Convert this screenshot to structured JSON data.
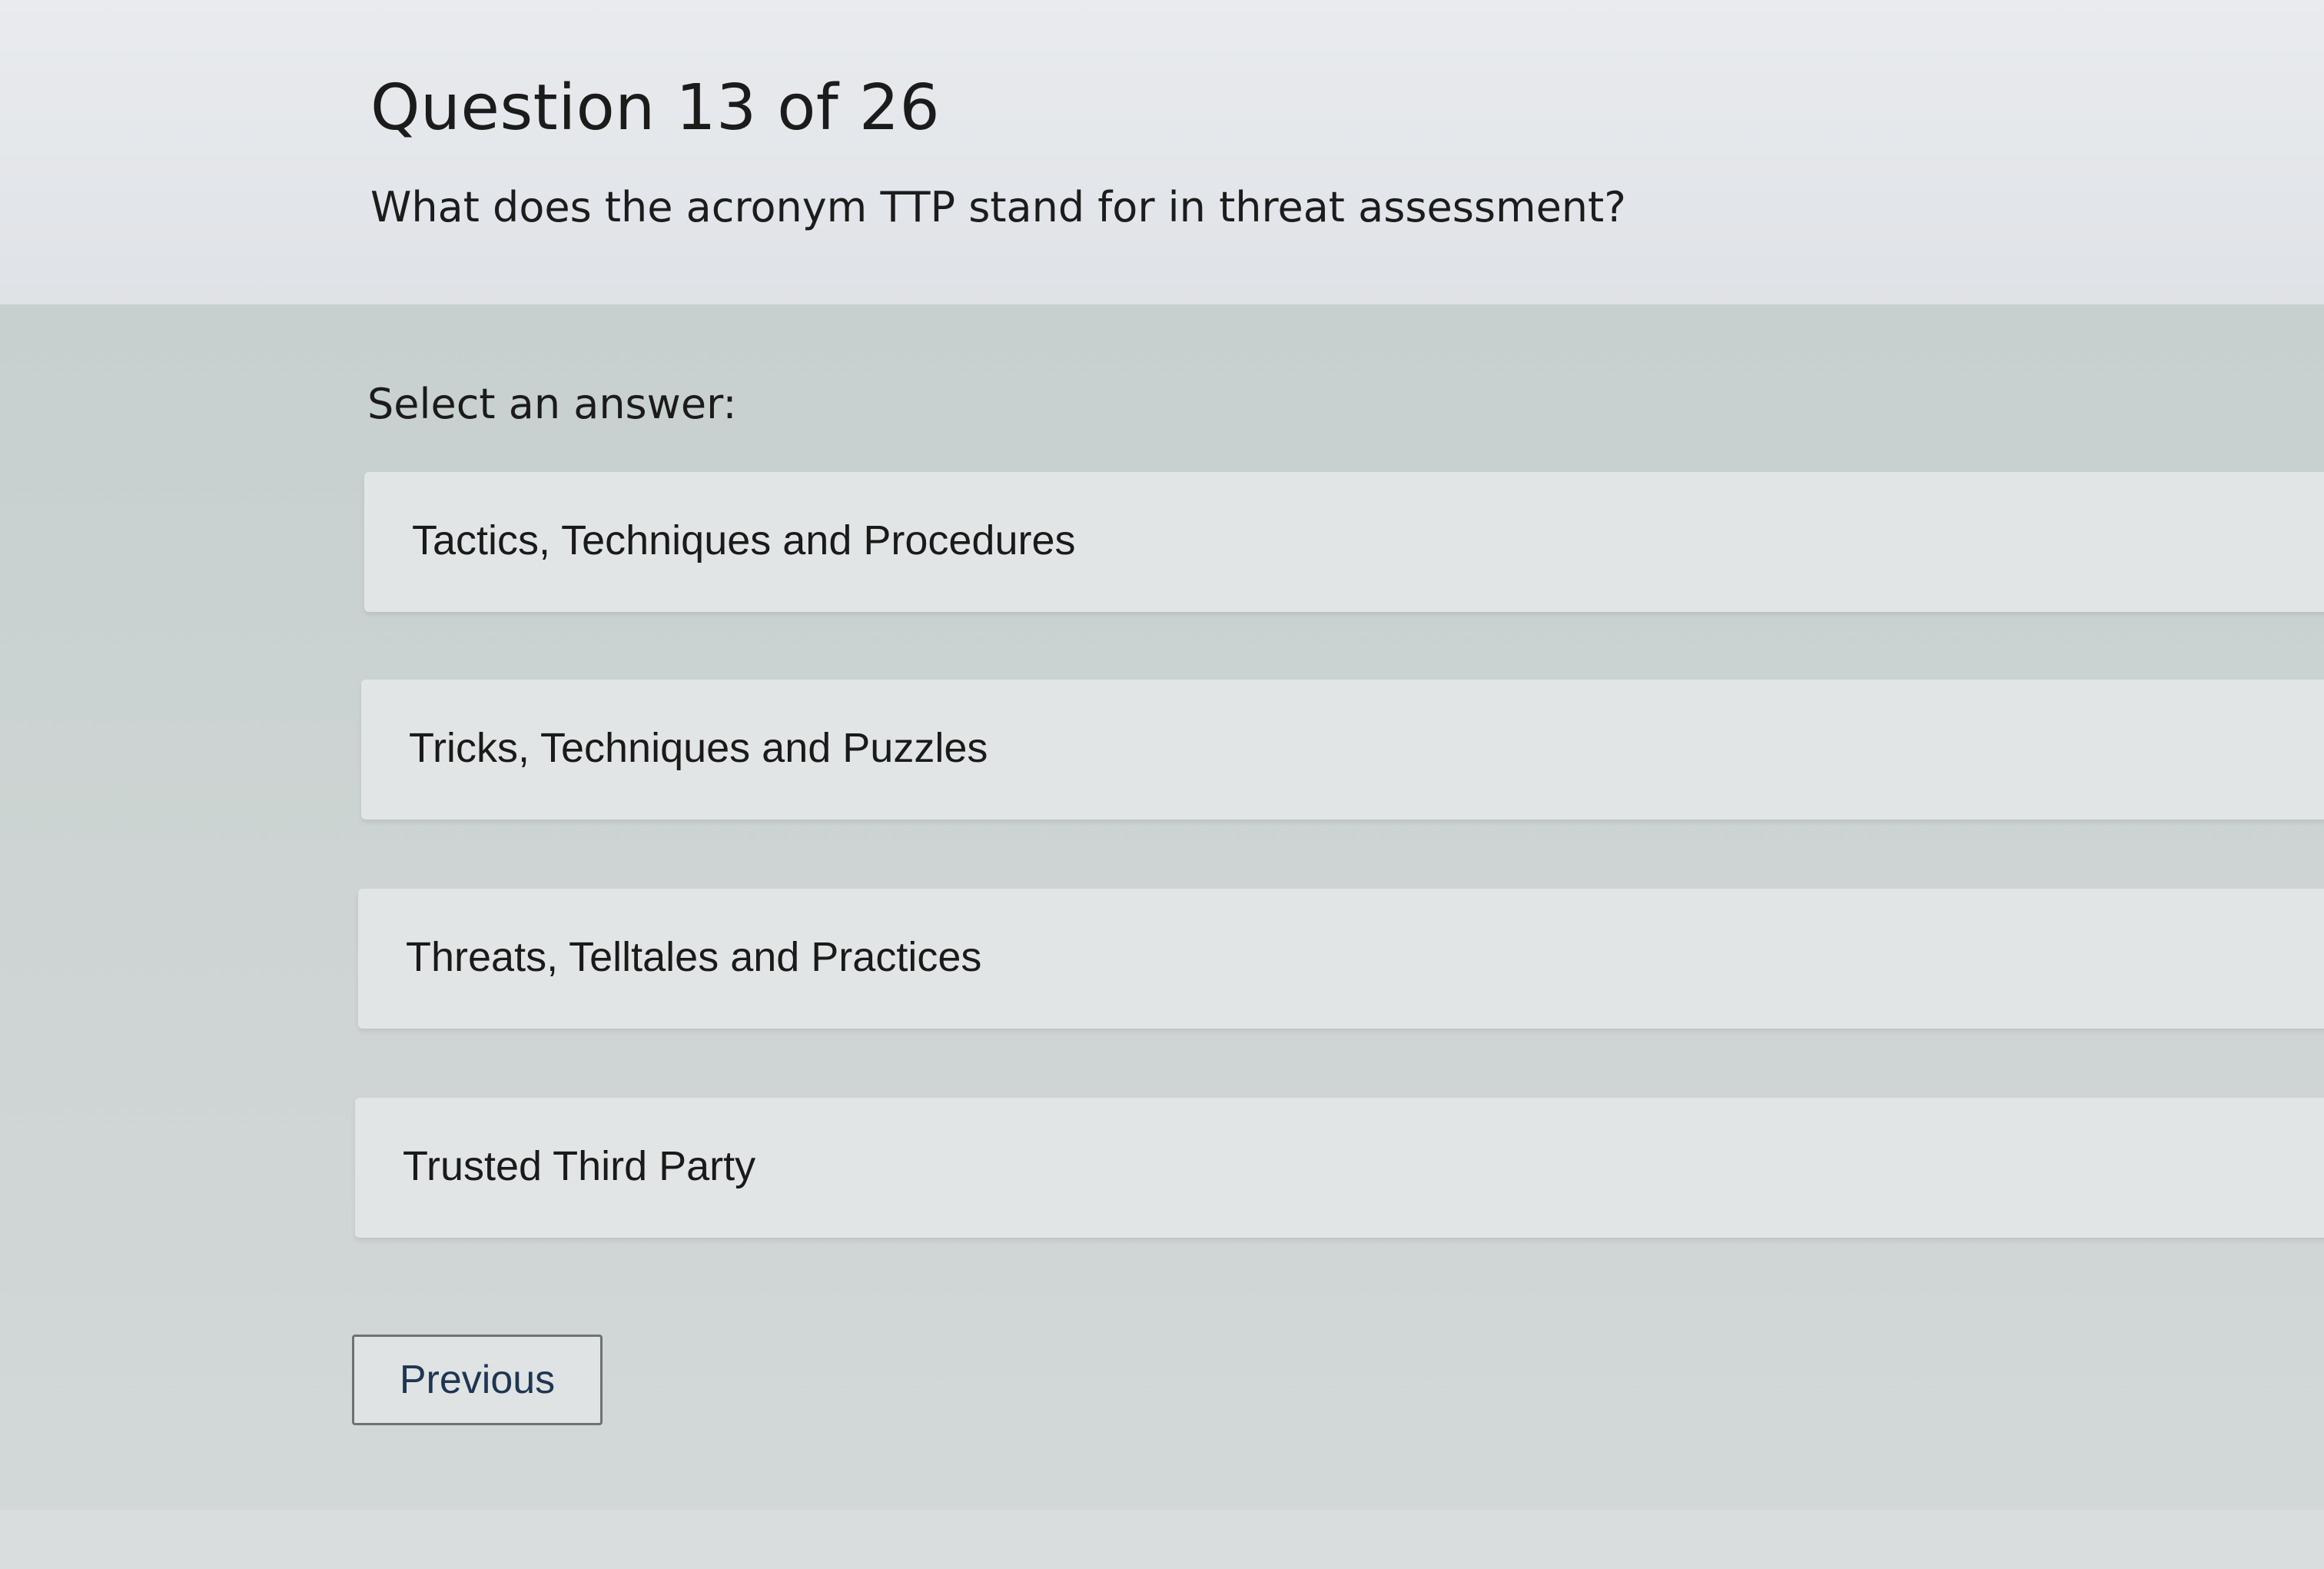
{
  "quiz": {
    "heading": "Question 13 of 26",
    "question": "What does the acronym TTP stand for in threat assessment?",
    "select_prompt": "Select an answer:",
    "options": [
      {
        "label": "Tactics, Techniques and Procedures"
      },
      {
        "label": "Tricks, Techniques and Puzzles"
      },
      {
        "label": "Threats, Telltales and Practices"
      },
      {
        "label": "Trusted Third Party"
      }
    ]
  },
  "navigation": {
    "previous_label": "Previous"
  }
}
